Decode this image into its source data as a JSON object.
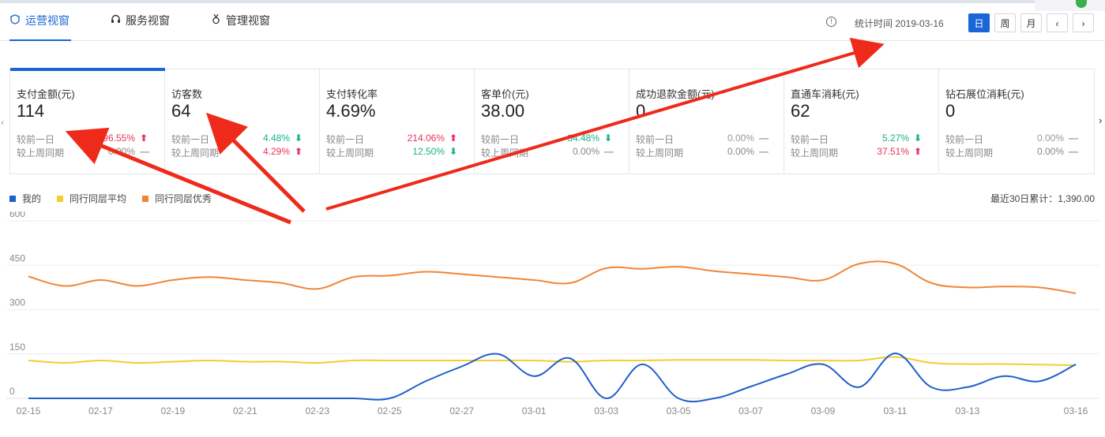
{
  "tabs": [
    {
      "label": "运营视窗",
      "icon": "shield-icon"
    },
    {
      "label": "服务视窗",
      "icon": "headset-icon"
    },
    {
      "label": "管理视窗",
      "icon": "medal-icon"
    }
  ],
  "header": {
    "stat_time_label": "统计时间 2019-03-16",
    "period_buttons": [
      "日",
      "周",
      "月"
    ],
    "prev_symbol": "‹",
    "next_symbol": "›"
  },
  "cards": [
    {
      "title": "支付金额(元)",
      "value": "114",
      "day_label": "较前一日",
      "day_value": "96.55%",
      "day_trend": "up",
      "week_label": "较上周同期",
      "week_value": "0.00%",
      "week_trend": "flat"
    },
    {
      "title": "访客数",
      "value": "64",
      "day_label": "较前一日",
      "day_value": "4.48%",
      "day_trend": "down",
      "week_label": "较上周同期",
      "week_value": "4.29%",
      "week_trend": "up"
    },
    {
      "title": "支付转化率",
      "value": "4.69%",
      "day_label": "较前一日",
      "day_value": "214.06%",
      "day_trend": "up",
      "week_label": "较上周同期",
      "week_value": "12.50%",
      "week_trend": "down"
    },
    {
      "title": "客单价(元)",
      "value": "38.00",
      "day_label": "较前一日",
      "day_value": "34.48%",
      "day_trend": "down",
      "week_label": "较上周同期",
      "week_value": "0.00%",
      "week_trend": "flat"
    },
    {
      "title": "成功退款金额(元)",
      "value": "0",
      "day_label": "较前一日",
      "day_value": "0.00%",
      "day_trend": "flat",
      "week_label": "较上周同期",
      "week_value": "0.00%",
      "week_trend": "flat"
    },
    {
      "title": "直通车消耗(元)",
      "value": "62",
      "day_label": "较前一日",
      "day_value": "5.27%",
      "day_trend": "down",
      "week_label": "较上周同期",
      "week_value": "37.51%",
      "week_trend": "up"
    },
    {
      "title": "钻石展位消耗(元)",
      "value": "0",
      "day_label": "较前一日",
      "day_value": "0.00%",
      "day_trend": "flat",
      "week_label": "较上周同期",
      "week_value": "0.00%",
      "week_trend": "flat"
    }
  ],
  "summary": {
    "total_label": "最近30日累计：1,390.00"
  },
  "colors": {
    "accent": "#1a66d6",
    "up": "#e8335d",
    "down": "#17b28a",
    "annotation_arrow": "#ee2b1b"
  },
  "chart_data": {
    "type": "line",
    "x": [
      "02-15",
      "02-16",
      "02-17",
      "02-18",
      "02-19",
      "02-20",
      "02-21",
      "02-22",
      "02-23",
      "02-24",
      "02-25",
      "02-26",
      "02-27",
      "02-28",
      "03-01",
      "03-02",
      "03-03",
      "03-04",
      "03-05",
      "03-06",
      "03-07",
      "03-08",
      "03-09",
      "03-10",
      "03-11",
      "03-12",
      "03-13",
      "03-14",
      "03-15",
      "03-16"
    ],
    "x_tick_labels": [
      "02-15",
      "02-17",
      "02-19",
      "02-21",
      "02-23",
      "02-25",
      "02-27",
      "03-01",
      "03-03",
      "03-05",
      "03-07",
      "03-09",
      "03-11",
      "03-13",
      "03-16"
    ],
    "ylim": [
      0,
      600
    ],
    "y_ticks": [
      0,
      150,
      300,
      450,
      600
    ],
    "grid": true,
    "legend_position": "top-left",
    "series": [
      {
        "name": "我的",
        "color": "#1f5fc9",
        "values": [
          0,
          0,
          0,
          0,
          0,
          0,
          0,
          0,
          0,
          0,
          0,
          58,
          108,
          150,
          75,
          135,
          0,
          115,
          0,
          0,
          40,
          82,
          115,
          38,
          152,
          38,
          38,
          75,
          58,
          115
        ]
      },
      {
        "name": "同行同层平均",
        "color": "#f2cf2d",
        "values": [
          128,
          120,
          128,
          120,
          124,
          128,
          124,
          124,
          120,
          128,
          128,
          128,
          128,
          128,
          128,
          124,
          128,
          128,
          130,
          130,
          130,
          128,
          128,
          128,
          140,
          120,
          116,
          116,
          114,
          112
        ]
      },
      {
        "name": "同行同层优秀",
        "color": "#f08537",
        "values": [
          412,
          380,
          400,
          380,
          400,
          410,
          400,
          390,
          370,
          410,
          415,
          428,
          420,
          410,
          400,
          390,
          440,
          438,
          445,
          430,
          420,
          410,
          400,
          455,
          455,
          390,
          375,
          378,
          375,
          355
        ]
      }
    ]
  }
}
